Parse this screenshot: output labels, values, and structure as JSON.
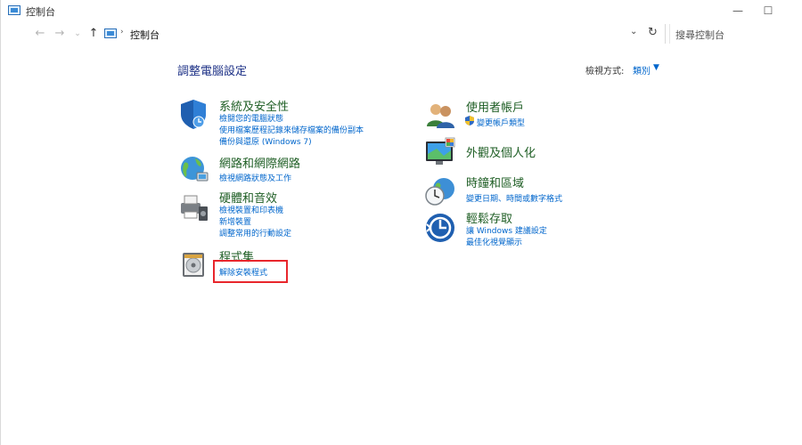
{
  "window": {
    "title": "控制台",
    "minimize": "—",
    "maximize": "☐"
  },
  "nav": {
    "back": "←",
    "forward": "→",
    "recent": "⌄",
    "up": "↑",
    "address_sep": "›",
    "address": "控制台",
    "dropdown": "⌄",
    "refresh": "↻",
    "search_placeholder": "搜尋控制台"
  },
  "main": {
    "title": "調整電腦設定",
    "view_by_label": "檢視方式:",
    "view_by_value": "類別",
    "view_by_arrow": "▼"
  },
  "categories": [
    {
      "title": "系統及安全性",
      "icon": "shield-icon",
      "links": [
        "檢閱您的電腦狀態",
        "使用檔案歷程記錄來儲存檔案的備份副本",
        "備份與還原 (Windows 7)"
      ]
    },
    {
      "title": "網路和網際網路",
      "icon": "network-globe-icon",
      "links": [
        "檢視網路狀態及工作"
      ]
    },
    {
      "title": "硬體和音效",
      "icon": "printer-speaker-icon",
      "links": [
        "檢視裝置和印表機",
        "新增裝置",
        "調整常用的行動設定"
      ]
    },
    {
      "title": "程式集",
      "icon": "programs-disc-icon",
      "links": [
        "解除安裝程式"
      ]
    },
    {
      "title": "使用者帳戶",
      "icon": "users-icon",
      "links": [
        "變更帳戶類型"
      ]
    },
    {
      "title": "外觀及個人化",
      "icon": "monitor-palette-icon",
      "links": []
    },
    {
      "title": "時鐘和區域",
      "icon": "clock-globe-icon",
      "links": [
        "變更日期、時間或數字格式"
      ]
    },
    {
      "title": "輕鬆存取",
      "icon": "ease-of-access-icon",
      "links": [
        "讓 Windows 建議設定",
        "最佳化視覺顯示"
      ]
    }
  ],
  "colors": {
    "category_title": "#1e5e24",
    "link": "#0066cc",
    "page_title": "#1e3287",
    "highlight": "#e8262c"
  }
}
